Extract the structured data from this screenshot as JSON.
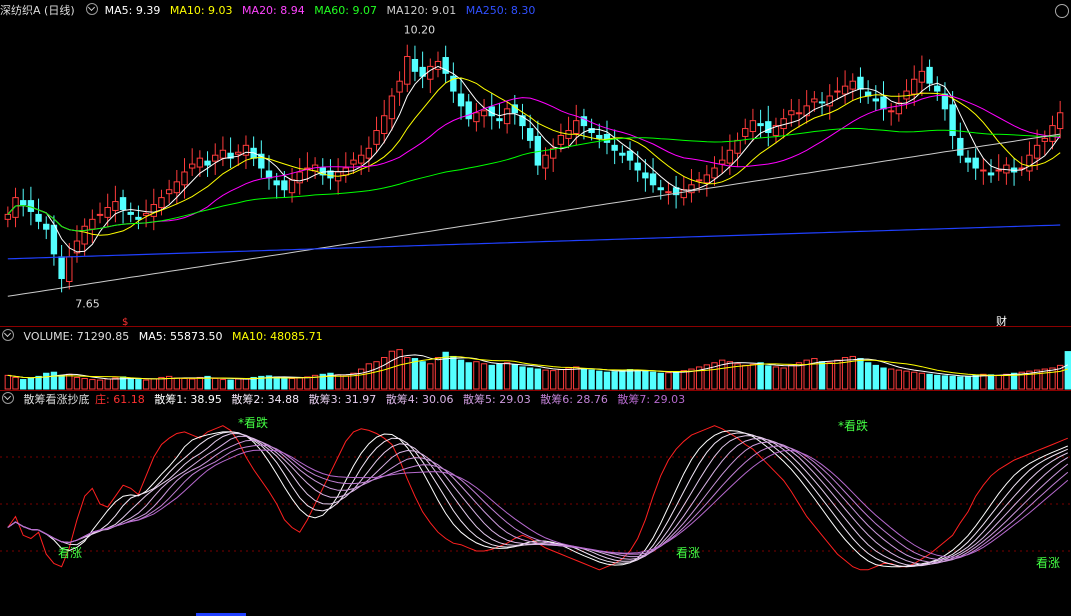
{
  "price_panel": {
    "title": "深纺织A (日线)",
    "ma5": "MA5: 9.39",
    "ma10": "MA10: 9.03",
    "ma20": "MA20: 8.94",
    "ma60": "MA60: 9.07",
    "ma120": "MA120: 9.01",
    "ma250": "MA250: 8.30",
    "high_label": "10.20",
    "low_label": "7.65",
    "marker_s": "$",
    "marker_cai": "财"
  },
  "volume_panel": {
    "label": "VOLUME: 71290.85",
    "ma5": "MA5: 55873.50",
    "ma10": "MA10: 48085.71"
  },
  "indicator_panel": {
    "name": "散筹看涨抄底",
    "zhuang": "庄: 61.18",
    "s1": "散筹1: 38.95",
    "s2": "散筹2: 34.88",
    "s3": "散筹3: 31.97",
    "s4": "散筹4: 30.06",
    "s5": "散筹5: 29.03",
    "s6": "散筹6: 28.76",
    "s7": "散筹7: 29.03",
    "signal_up": "看涨",
    "signal_down": "*看跌"
  },
  "colors": {
    "up": "#ff3c3c",
    "down": "#54ffff",
    "ma5": "#ffffff",
    "ma10": "#ffff00",
    "ma20": "#ff00ff",
    "ma60": "#00ff00",
    "ma120": "#cccccc",
    "ma250": "#2040ff",
    "zhuang": "#ff2020",
    "signal": "#44ff44"
  },
  "chart_data": {
    "type": "candlestick",
    "price_ylim": [
      7.4,
      10.4
    ],
    "closes": [
      8.45,
      8.62,
      8.55,
      8.48,
      8.38,
      8.3,
      8.05,
      7.8,
      8.02,
      8.18,
      8.33,
      8.4,
      8.45,
      8.52,
      8.58,
      8.5,
      8.45,
      8.4,
      8.46,
      8.55,
      8.62,
      8.7,
      8.78,
      8.88,
      8.96,
      9.02,
      8.95,
      9.05,
      9.1,
      9.02,
      9.08,
      9.15,
      9.02,
      8.92,
      8.82,
      8.75,
      8.7,
      8.8,
      8.88,
      8.92,
      8.95,
      8.85,
      8.82,
      8.88,
      8.92,
      9.0,
      9.05,
      9.12,
      9.3,
      9.45,
      9.65,
      9.8,
      10.05,
      9.9,
      9.85,
      9.95,
      10.0,
      9.88,
      9.7,
      9.55,
      9.42,
      9.48,
      9.5,
      9.45,
      9.4,
      9.52,
      9.48,
      9.35,
      9.2,
      8.95,
      9.05,
      9.12,
      9.25,
      9.3,
      9.4,
      9.35,
      9.28,
      9.22,
      9.18,
      9.1,
      9.05,
      9.0,
      8.9,
      8.82,
      8.75,
      8.7,
      8.68,
      8.65,
      8.7,
      8.75,
      8.8,
      8.85,
      8.92,
      9.0,
      9.1,
      9.2,
      9.32,
      9.4,
      9.35,
      9.28,
      9.35,
      9.42,
      9.5,
      9.48,
      9.55,
      9.62,
      9.58,
      9.65,
      9.7,
      9.75,
      9.8,
      9.72,
      9.65,
      9.6,
      9.52,
      9.5,
      9.58,
      9.7,
      9.82,
      9.9,
      9.78,
      9.7,
      9.52,
      9.25,
      9.05,
      8.98,
      8.92,
      8.9,
      8.85,
      8.9,
      8.95,
      8.88,
      8.92,
      9.05,
      9.15,
      9.22,
      9.35,
      9.48
    ],
    "volume_ylim": [
      0,
      80000
    ],
    "volumes": [
      26000,
      22000,
      18000,
      20000,
      24000,
      30000,
      32000,
      26000,
      28000,
      22000,
      20000,
      18000,
      17000,
      19000,
      21000,
      23000,
      20000,
      18000,
      17000,
      19000,
      22000,
      24000,
      21000,
      20000,
      19000,
      22000,
      24000,
      20000,
      18000,
      17000,
      19000,
      20000,
      22000,
      24000,
      25000,
      23000,
      21000,
      20000,
      21000,
      23000,
      26000,
      28000,
      30000,
      27000,
      25000,
      30000,
      38000,
      48000,
      52000,
      60000,
      72000,
      75000,
      60000,
      58000,
      52000,
      48000,
      60000,
      70000,
      62000,
      55000,
      50000,
      52000,
      48000,
      45000,
      47000,
      50000,
      46000,
      42000,
      40000,
      38000,
      36000,
      35000,
      37000,
      40000,
      42000,
      38000,
      36000,
      34000,
      32000,
      33000,
      35000,
      37000,
      36000,
      34000,
      32000,
      30000,
      31000,
      33000,
      35000,
      38000,
      42000,
      46000,
      50000,
      55000,
      52000,
      48000,
      45000,
      47000,
      50000,
      44000,
      42000,
      40000,
      45000,
      50000,
      55000,
      58000,
      52000,
      50000,
      55000,
      60000,
      62000,
      58000,
      50000,
      45000,
      40000,
      38000,
      36000,
      34000,
      32000,
      30000,
      28000,
      26000,
      25000,
      24000,
      23000,
      24000,
      26000,
      28000,
      27000,
      26000,
      28000,
      30000,
      32000,
      34000,
      36000,
      38000,
      40000,
      45000,
      71290
    ],
    "indicator_ylim": [
      -10,
      110
    ],
    "zhuang": [
      35,
      42,
      30,
      28,
      32,
      18,
      12,
      10,
      22,
      40,
      55,
      60,
      50,
      48,
      55,
      62,
      60,
      56,
      68,
      80,
      88,
      92,
      95,
      96,
      94,
      92,
      96,
      98,
      100,
      97,
      90,
      80,
      72,
      65,
      58,
      50,
      40,
      35,
      32,
      40,
      50,
      60,
      70,
      80,
      90,
      96,
      98,
      97,
      95,
      92,
      88,
      78,
      66,
      55,
      45,
      38,
      32,
      28,
      25,
      24,
      22,
      20,
      20,
      21,
      23,
      25,
      28,
      30,
      28,
      25,
      22,
      20,
      18,
      16,
      14,
      12,
      10,
      8,
      10,
      12,
      15,
      20,
      28,
      40,
      55,
      68,
      78,
      85,
      90,
      94,
      96,
      98,
      100,
      98,
      95,
      92,
      88,
      85,
      80,
      75,
      70,
      65,
      58,
      50,
      42,
      36,
      30,
      24,
      18,
      14,
      10,
      8,
      8,
      10,
      12,
      12,
      10,
      10,
      12,
      15,
      18,
      22,
      26,
      30,
      38,
      45,
      55,
      62,
      68,
      72,
      75,
      78,
      80,
      82,
      84,
      86,
      88,
      90,
      92
    ]
  }
}
